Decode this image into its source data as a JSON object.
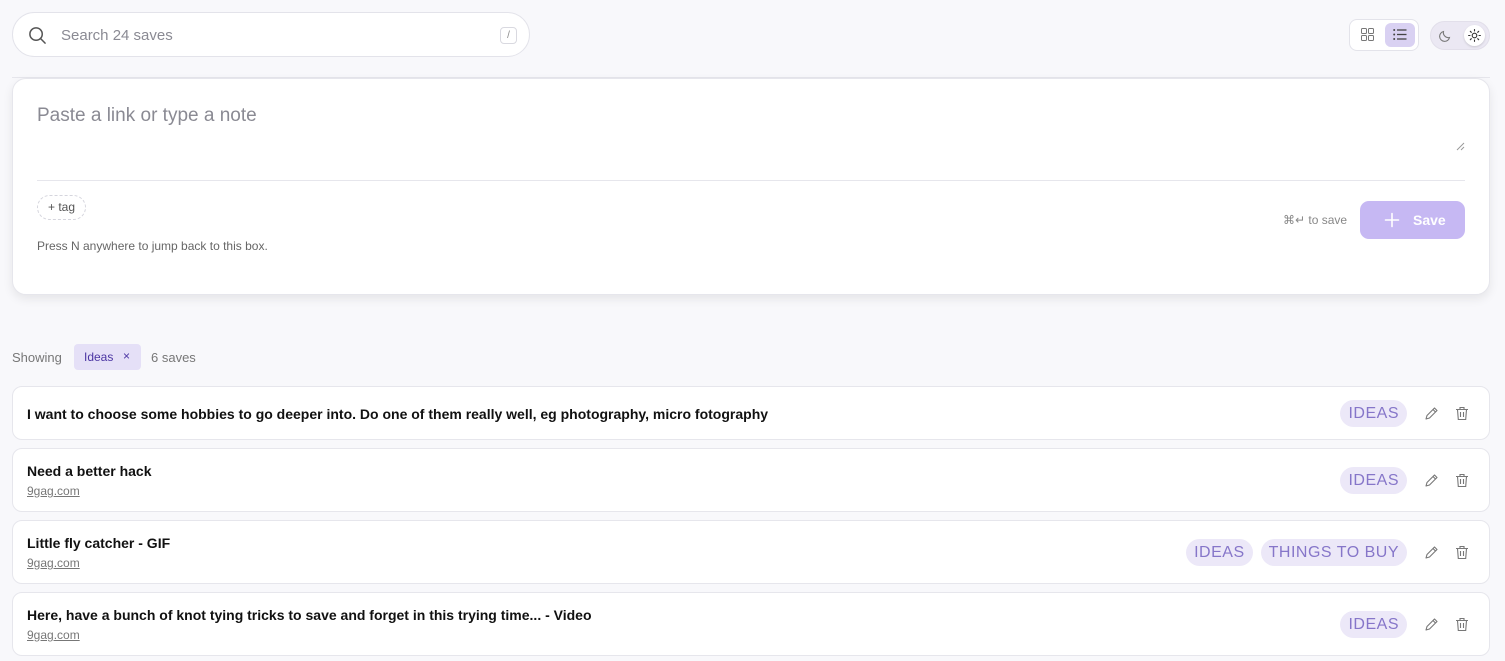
{
  "search": {
    "placeholder": "Search 24 saves",
    "shortcut": "/"
  },
  "view_toggle": {
    "active": "list"
  },
  "composer": {
    "placeholder": "Paste a link or type a note",
    "tag_button": "+ tag",
    "hint": "Press N anywhere to jump back to this box.",
    "shortcut_hint": "⌘↵ to save",
    "save_label": "Save"
  },
  "filter": {
    "showing_label": "Showing",
    "active_tag": "Ideas",
    "remove_glyph": "×",
    "count_label": "6 saves"
  },
  "colors": {
    "accent": "#c6b8f3",
    "tag_bg": "#ece8f8",
    "tag_text": "#8676c9",
    "chip_bg": "#e5e0f7"
  },
  "items": [
    {
      "title": "I want to choose some hobbies to go deeper into. Do one of them really well, eg photography, micro fotography",
      "domain": "",
      "tags": [
        "IDEAS"
      ]
    },
    {
      "title": "Need a better hack",
      "domain": "9gag.com",
      "tags": [
        "IDEAS"
      ]
    },
    {
      "title": "Little fly catcher - GIF",
      "domain": "9gag.com",
      "tags": [
        "IDEAS",
        "THINGS TO BUY"
      ]
    },
    {
      "title": "Here, have a bunch of knot tying tricks to save and forget in this trying time... - Video",
      "domain": "9gag.com",
      "tags": [
        "IDEAS"
      ]
    }
  ]
}
